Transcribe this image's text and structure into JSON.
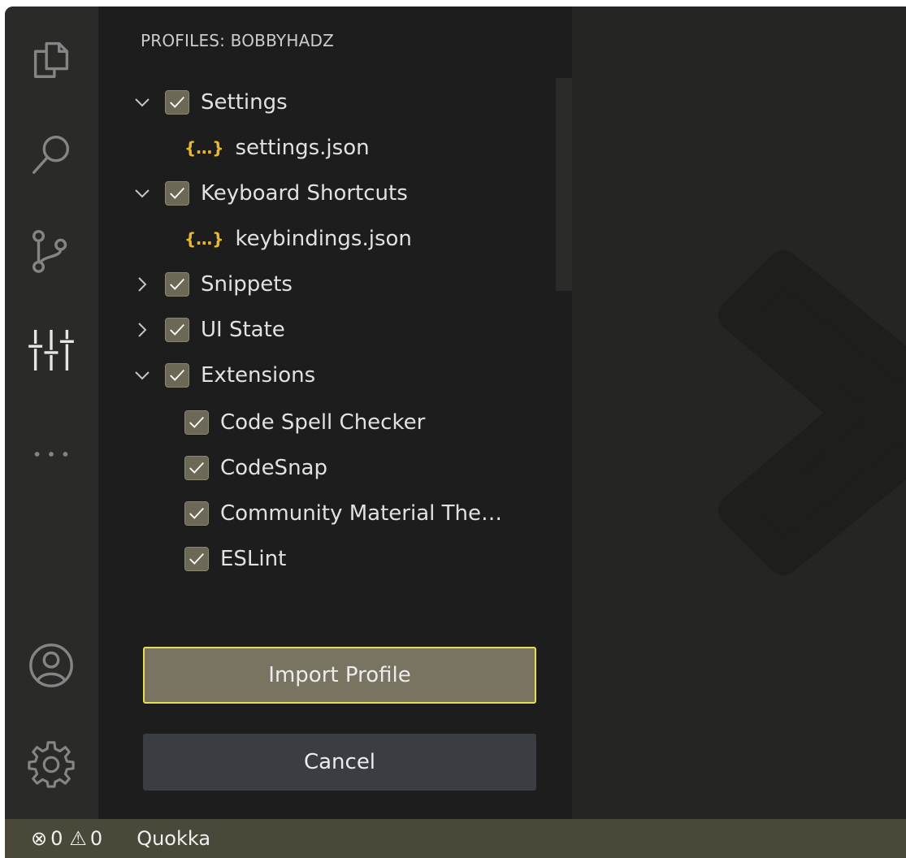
{
  "sidebar": {
    "title": "PROFILES: BOBBYHADZ",
    "items": [
      {
        "label": "Settings",
        "expanded": true,
        "checked": true
      },
      {
        "label": "settings.json",
        "icon": "json-icon"
      },
      {
        "label": "Keyboard Shortcuts",
        "expanded": true,
        "checked": true
      },
      {
        "label": "keybindings.json",
        "icon": "json-icon"
      },
      {
        "label": "Snippets",
        "expanded": false,
        "checked": true
      },
      {
        "label": "UI State",
        "expanded": false,
        "checked": true
      },
      {
        "label": "Extensions",
        "expanded": true,
        "checked": true
      },
      {
        "label": "Code Spell Checker",
        "checked": true
      },
      {
        "label": "CodeSnap",
        "checked": true
      },
      {
        "label": "Community Material The…",
        "checked": true
      },
      {
        "label": "ESLint",
        "checked": true
      }
    ],
    "json_icon_glyph": "{…}",
    "import_button": "Import Profile",
    "cancel_button": "Cancel"
  },
  "statusbar": {
    "errors": "0",
    "warnings": "0",
    "error_glyph": "⊗",
    "warning_glyph": "⚠",
    "quokka": "Quokka"
  },
  "colors": {
    "accent_border": "#e6df55",
    "json_icon": "#e8b92b",
    "statusbar_bg": "#4a4838"
  }
}
